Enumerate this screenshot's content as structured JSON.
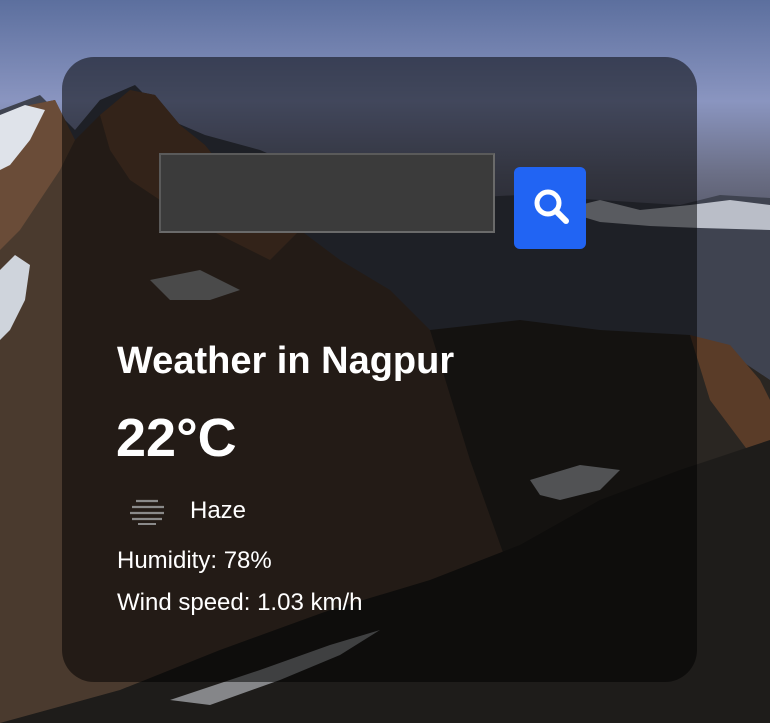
{
  "background": {
    "description_icon": "mountain-landscape"
  },
  "search": {
    "value": "",
    "placeholder": "",
    "button_icon": "search-icon",
    "button_color": "#2164f3"
  },
  "weather": {
    "title": "Weather in Nagpur",
    "temperature": "22°C",
    "condition": "Haze",
    "condition_icon": "haze-icon",
    "humidity": "Humidity: 78%",
    "wind_speed": "Wind speed: 1.03 km/h"
  }
}
